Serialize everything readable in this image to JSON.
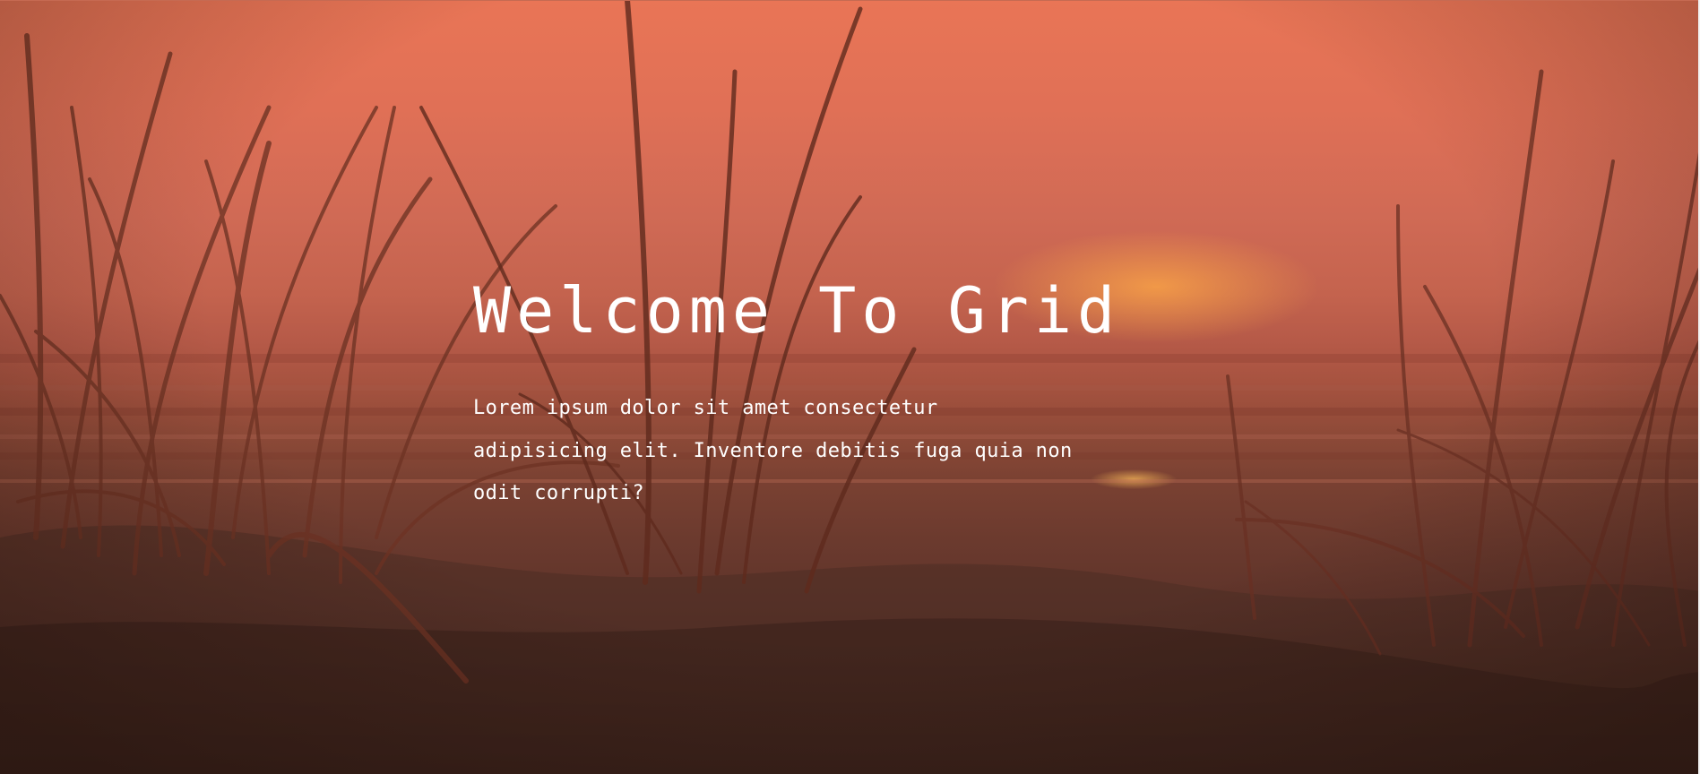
{
  "hero": {
    "title": "Welcome To Grid",
    "text": "Lorem ipsum dolor sit amet consectetur adipisicing elit. Inventore debitis fuga quia non odit corrupti?",
    "background_image": "sunset-beach-grass",
    "overlay_color": "#e97556"
  }
}
